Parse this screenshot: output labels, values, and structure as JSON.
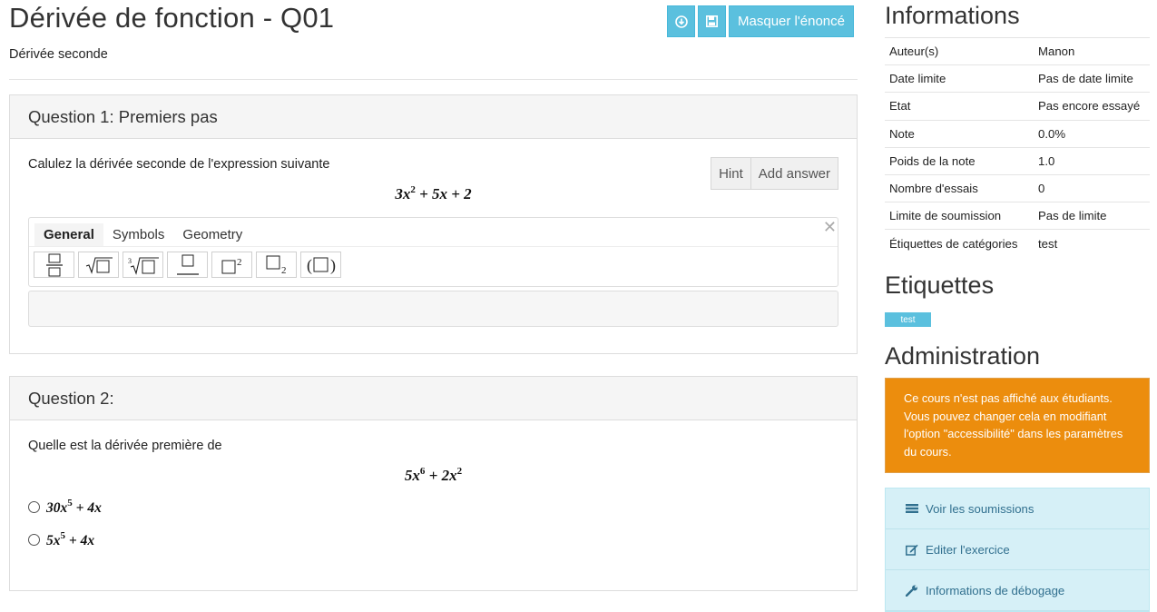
{
  "page": {
    "title": "Dérivée de fonction - Q01",
    "subtitle": "Dérivée seconde",
    "toolbar": {
      "download_icon": "download-icon",
      "save_icon": "save-icon",
      "hide_statement_label": "Masquer l'énoncé"
    }
  },
  "questions": [
    {
      "heading": "Question 1: Premiers pas",
      "text": "Calulez la dérivée seconde de l'expression suivante",
      "hint_label": "Hint",
      "add_answer_label": "Add answer",
      "expression": {
        "a": "3x",
        "a_exp": "2",
        "rest": " + 5x + 2"
      },
      "editor": {
        "tabs": [
          "General",
          "Symbols",
          "Geometry"
        ],
        "active_tab": "General",
        "close_glyph": "✕",
        "symbols": [
          "fraction",
          "sqrt",
          "cube-root",
          "overline",
          "superscript",
          "subscript",
          "parentheses"
        ]
      }
    },
    {
      "heading": "Question 2:",
      "text": "Quelle est la dérivée première de",
      "expression": {
        "a": "5x",
        "a_exp": "6",
        "b": " + 2x",
        "b_exp": "2"
      },
      "choices": [
        {
          "base": "30x",
          "exp": "5",
          "rest": " + 4x"
        },
        {
          "base": "5x",
          "exp": "5",
          "rest": " + 4x"
        }
      ]
    }
  ],
  "sidebar": {
    "info_title": "Informations",
    "info": [
      {
        "key": "Auteur(s)",
        "value": "Manon"
      },
      {
        "key": "Date limite",
        "value": "Pas de date limite"
      },
      {
        "key": "Etat",
        "value": "Pas encore essayé"
      },
      {
        "key": "Note",
        "value": "0.0%"
      },
      {
        "key": "Poids de la note",
        "value": "1.0"
      },
      {
        "key": "Nombre d'essais",
        "value": "0"
      },
      {
        "key": "Limite de soumission",
        "value": "Pas de limite"
      },
      {
        "key": "Étiquettes de catégories",
        "value": "test"
      }
    ],
    "tags_title": "Etiquettes",
    "tag": "test",
    "admin_title": "Administration",
    "alert": "Ce cours n'est pas affiché aux étudiants. Vous pouvez changer cela en modifiant l'option \"accessibilité\" dans les paramètres du cours.",
    "admin_items": [
      {
        "label": "Voir les soumissions",
        "icon": "list-icon"
      },
      {
        "label": "Editer l'exercice",
        "icon": "edit-icon"
      },
      {
        "label": "Informations de débogage",
        "icon": "wrench-icon"
      }
    ]
  },
  "colors": {
    "info_button": "#5bc0de",
    "alert_bg": "#ec8d0d",
    "admin_item_bg": "#d6f0f7"
  }
}
